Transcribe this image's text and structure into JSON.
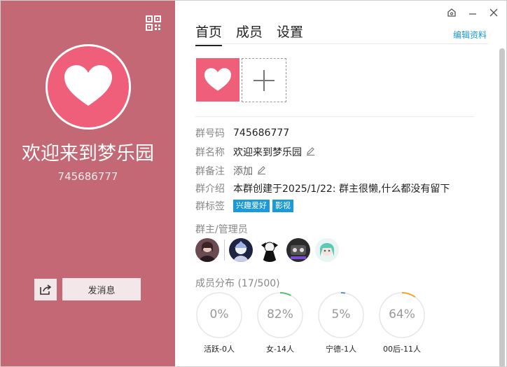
{
  "left_panel": {
    "group_name": "欢迎来到梦乐园",
    "group_id": "745686777",
    "send_button": "发消息",
    "accent": "#c36874",
    "avatar_color": "#f05f79"
  },
  "window": {
    "icons": [
      "skin-icon",
      "minimize-icon",
      "close-icon"
    ]
  },
  "tabs": [
    {
      "label": "首页",
      "active": true
    },
    {
      "label": "成员",
      "active": false
    },
    {
      "label": "设置",
      "active": false
    }
  ],
  "edit_link": "编辑资料",
  "info": {
    "group_no": {
      "label": "群号码",
      "value": "745686777"
    },
    "group_name": {
      "label": "群名称",
      "value": "欢迎来到梦乐园"
    },
    "remark": {
      "label": "群备注",
      "value": "添加"
    },
    "intro": {
      "label": "群介绍",
      "value": "本群创建于2025/1/22:  群主很懒,什么都没有留下"
    },
    "tags": {
      "label": "群标签",
      "values": [
        "兴趣爱好",
        "影视"
      ]
    }
  },
  "admins_label": "群主/管理员",
  "distribution": {
    "label": "成员分布 (17/500)",
    "stats": [
      {
        "pct": "0%",
        "fraction": 0.0,
        "caption": "活跃-0人",
        "color": "#56c46d"
      },
      {
        "pct": "82%",
        "fraction": 0.08,
        "caption": "女-14人",
        "color": "#56c46d"
      },
      {
        "pct": "5%",
        "fraction": 0.03,
        "caption": "宁德-1人",
        "color": "#4a8fe0"
      },
      {
        "pct": "64%",
        "fraction": 0.1,
        "caption": "00后-11人",
        "color": "#f2a227"
      }
    ]
  }
}
